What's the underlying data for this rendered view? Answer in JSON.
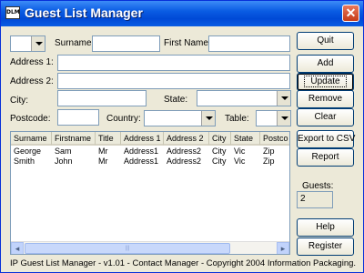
{
  "window": {
    "title": "Guest List Manager",
    "app_icon": "DLM",
    "close_glyph": "✕"
  },
  "form": {
    "title_combo_value": "",
    "surname_label": "Surname:",
    "surname_value": "",
    "firstname_label": "First Name:",
    "firstname_value": "",
    "address1_label": "Address 1:",
    "address1_value": "",
    "address2_label": "Address 2:",
    "address2_value": "",
    "city_label": "City:",
    "city_value": "",
    "state_label": "State:",
    "state_value": "",
    "postcode_label": "Postcode:",
    "postcode_value": "",
    "country_label": "Country:",
    "country_value": "",
    "table_label": "Table:",
    "table_value": ""
  },
  "buttons": {
    "quit": "Quit",
    "add": "Add",
    "update": "Update",
    "remove": "Remove",
    "clear": "Clear",
    "export": "Export to CSV",
    "report": "Report",
    "help": "Help",
    "register": "Register"
  },
  "guests": {
    "label": "Guests:",
    "count": "2"
  },
  "list": {
    "columns": [
      "Surname",
      "Firstname",
      "Title",
      "Address 1",
      "Address 2",
      "City",
      "State",
      "Postco"
    ],
    "rows": [
      [
        "George",
        "Sam",
        "Mr",
        "Address1",
        "Address2",
        "City",
        "Vic",
        "Zip"
      ],
      [
        "Smith",
        "John",
        "Mr",
        "Address1",
        "Address2",
        "City",
        "Vic",
        "Zip"
      ]
    ]
  },
  "status": {
    "text": "IP Guest List Manager - v1.01 - Contact Manager - Copyright 2004 Information Packaging."
  },
  "icons": {
    "scroll_left": "◂",
    "scroll_right": "▸",
    "thumb_grip": "|||"
  }
}
